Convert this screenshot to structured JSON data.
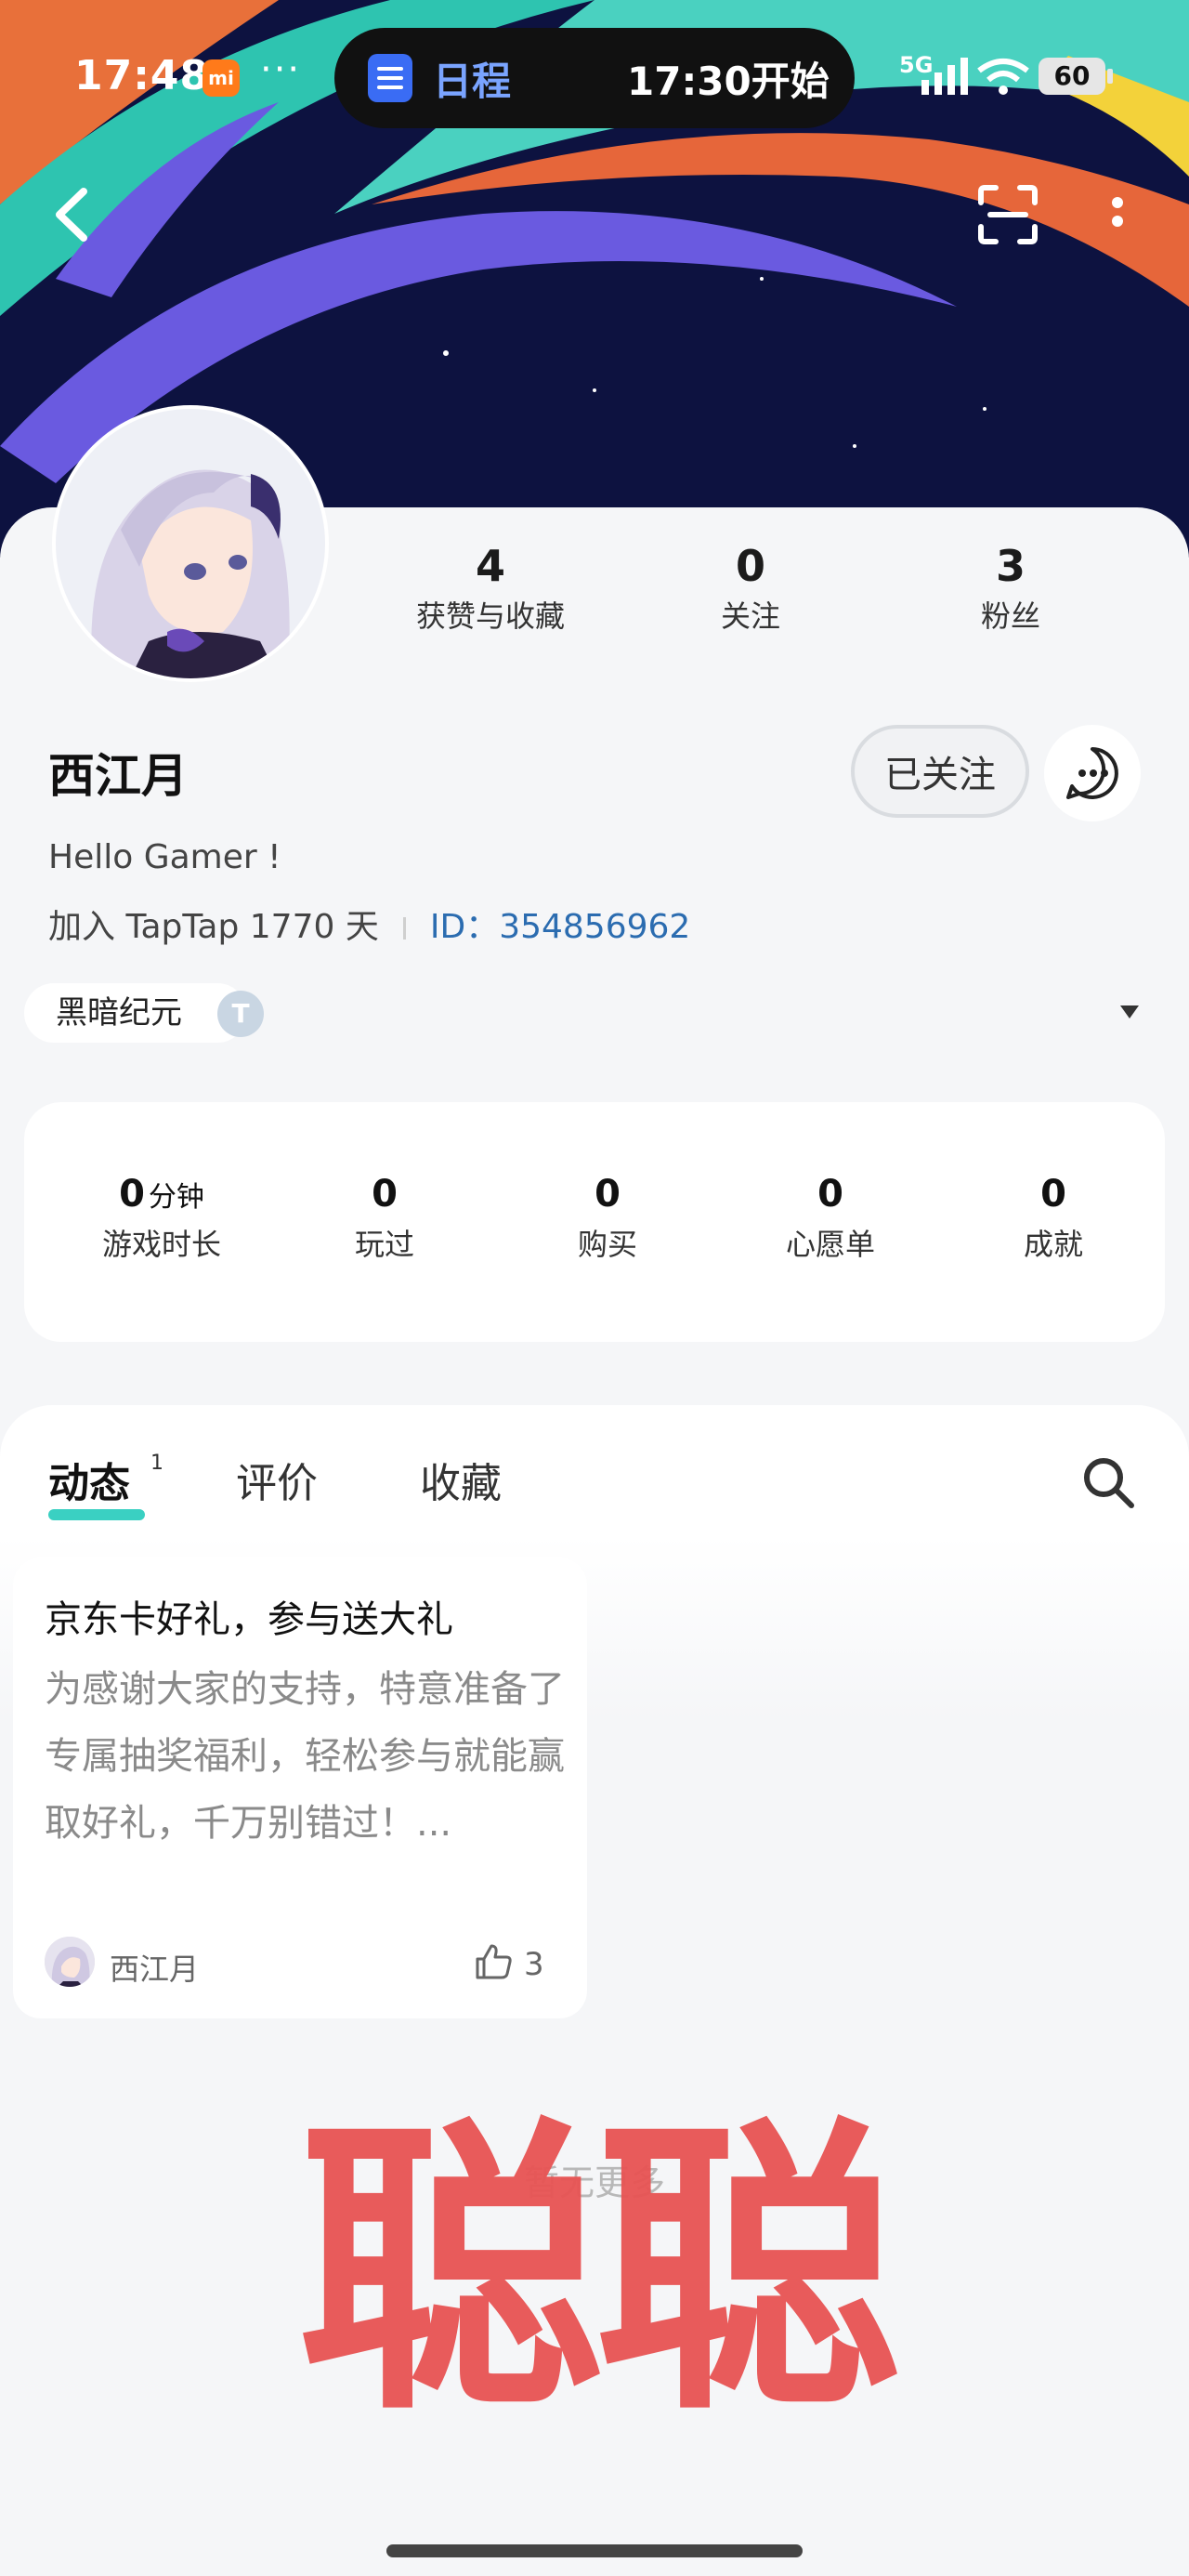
{
  "status_bar": {
    "time": "17:48",
    "mi_badge": "mi",
    "more": "···",
    "island_label": "日程",
    "island_time": "17:30开始",
    "network": "5G",
    "battery": "60"
  },
  "profile": {
    "username": "西江月",
    "follow_state": "已关注",
    "bio": "Hello Gamer !",
    "join_text": "加入 TapTap 1770 天",
    "id_label": "ID：",
    "id_value": "354856962",
    "game_chip": "黑暗纪元",
    "chip_badge": "T"
  },
  "counters": [
    {
      "value": "4",
      "label": "获赞与收藏"
    },
    {
      "value": "0",
      "label": "关注"
    },
    {
      "value": "3",
      "label": "粉丝"
    }
  ],
  "game_stats": [
    {
      "value": "0",
      "unit": "分钟",
      "label": "游戏时长"
    },
    {
      "value": "0",
      "unit": "",
      "label": "玩过"
    },
    {
      "value": "0",
      "unit": "",
      "label": "购买"
    },
    {
      "value": "0",
      "unit": "",
      "label": "心愿单"
    },
    {
      "value": "0",
      "unit": "",
      "label": "成就"
    }
  ],
  "tabs": {
    "items": [
      "动态",
      "评价",
      "收藏"
    ],
    "active_badge": "1"
  },
  "post": {
    "title": "京东卡好礼，参与送大礼",
    "body": "为感谢大家的支持，特意准备了专属抽奖福利，轻松参与就能赢取好礼，千万别错过！...",
    "author": "西江月",
    "likes": "3"
  },
  "footer": {
    "end_text": "暂无更多",
    "watermark": "聪聪"
  },
  "colors": {
    "accent_underline": "#3ad0c2",
    "id_link": "#2b6cb0",
    "watermark": "#e85353"
  }
}
